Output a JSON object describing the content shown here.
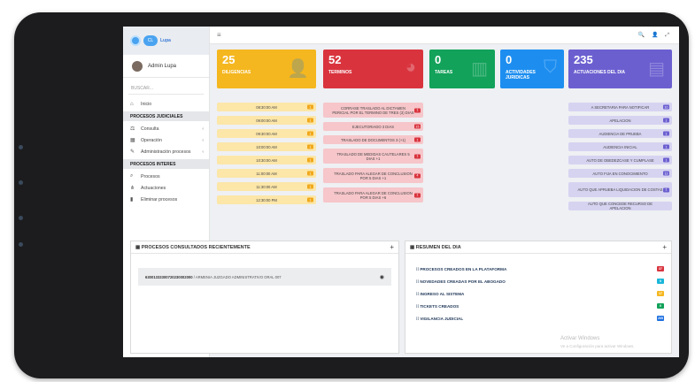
{
  "sidebar": {
    "logo_text": "CL Lupa Control",
    "user_name": "Admin Lupa",
    "search_placeholder": "BUSCAR...",
    "items": [
      {
        "label": "Inicio",
        "icon": "home-icon"
      },
      {
        "section": "PROCESOS JUDICIALES"
      },
      {
        "label": "Consulta",
        "icon": "gavel-icon",
        "arrow": "‹"
      },
      {
        "label": "Operación",
        "icon": "grid-icon",
        "arrow": "‹"
      },
      {
        "label": "Administración procesos",
        "icon": "wrench-icon",
        "arrow": "‹"
      },
      {
        "section": "PROCESOS INTERES"
      },
      {
        "label": "Procesos",
        "icon": "search-icon"
      },
      {
        "label": "Actuaciones",
        "icon": "sitemap-icon"
      },
      {
        "label": "Eliminar procesos",
        "icon": "trash-icon"
      }
    ]
  },
  "topbar": {
    "menu_icon": "hamburger-icon",
    "right_icons": "🔍 👤 ⤢"
  },
  "cards": [
    {
      "num": "25",
      "label": "DILIGENCIAS",
      "color": "#f5b71f",
      "icon": "user-plus-icon"
    },
    {
      "num": "52",
      "label": "TERMINOS",
      "color": "#d9343e",
      "icon": "pie-chart-icon"
    },
    {
      "num": "0",
      "label": "TAREAS",
      "color": "#12a25a",
      "icon": "bar-chart-icon"
    },
    {
      "num": "0",
      "label": "ACTIVIDADES JURIDICAS",
      "color": "#1d8ef0",
      "icon": "bag-icon"
    },
    {
      "num": "235",
      "label": "ACTUACIONES DEL DIA",
      "color": "#6b5fd0",
      "icon": "document-icon"
    }
  ],
  "diligencias": [
    "08:30:00 AM",
    "09:00:00 AM",
    "09:30:00 AM",
    "10:00:00 AM",
    "10:30:00 AM",
    "11:00:00 AM",
    "11:30:00 AM",
    "12:30:00 PM"
  ],
  "terminos": [
    {
      "text": "CORRASE TRASLADO AL DICTAMEN PERICIAL POR EL TERMINO DE TRES (3) DIAS",
      "badge": "1"
    },
    {
      "text": "EJECUTORIADO 3 DIAS",
      "badge": "15"
    },
    {
      "text": "TRASLADO DE DOCUMENTOS 3 (+1)",
      "badge": "1"
    },
    {
      "text": "TRASLADO DE MEDIDAS CAUTELARES 5 DIAS +1",
      "badge": "1"
    },
    {
      "text": "TRASLADO PARA ALEGAR DE CONCLUSION POR 5 DIAS +1",
      "badge": "4"
    },
    {
      "text": "TRASLADO PARA ALEGAR DE CONCLUSION POR 5 DIAS +6",
      "badge": "1"
    }
  ],
  "actuaciones": [
    {
      "text": "A SECRETARIA PARA NOTIFICAR",
      "badge": "10"
    },
    {
      "text": "APELACION",
      "badge": "1"
    },
    {
      "text": "AUDIENCIA DE PRUEBA",
      "badge": "1"
    },
    {
      "text": "AUDIENCIA INICIAL",
      "badge": "1"
    },
    {
      "text": "AUTO DE OBEDEZCASE Y CUMPLASE",
      "badge": "1"
    },
    {
      "text": "AUTO FIJA EN CONOCIMIENTO",
      "badge": "12"
    },
    {
      "text": "AUTO QUE APRUEBA LIQUIDACION DE COSTAS",
      "badge": "1"
    },
    {
      "text": "AUTO QUE CONCEDE RECURSO DE APELACION",
      "badge": ""
    }
  ],
  "procesos_panel": {
    "title": "PROCESOS CONSULTADOS RECIENTEMENTE",
    "plus": "+",
    "code": "63001333300720230002000",
    "desc": " / ARMENIA JUZGADO ADMINISTRATIVO ORAL 007"
  },
  "resumen_panel": {
    "title": "RESUMEN DEL DIA",
    "plus": "+",
    "rows": [
      {
        "label": "PROCESOS CREADOS EN LA PLATAFORMA",
        "badge": "37",
        "color": "#d9343e"
      },
      {
        "label": "NOVEDADES CREADAS POR EL ABOGADO",
        "badge": "0",
        "color": "#1ab6d8"
      },
      {
        "label": "INGRESO AL SISTEMA",
        "badge": "17",
        "color": "#f5b71f"
      },
      {
        "label": "TICKETS CREADOS",
        "badge": "0",
        "color": "#12a25a"
      },
      {
        "label": "VIGILANCIA JUDICIAL",
        "badge": "205",
        "color": "#1d6fe0"
      }
    ]
  },
  "watermark": {
    "title": "Activar Windows",
    "subtitle": "Ve a Configuración para activar Windows."
  }
}
